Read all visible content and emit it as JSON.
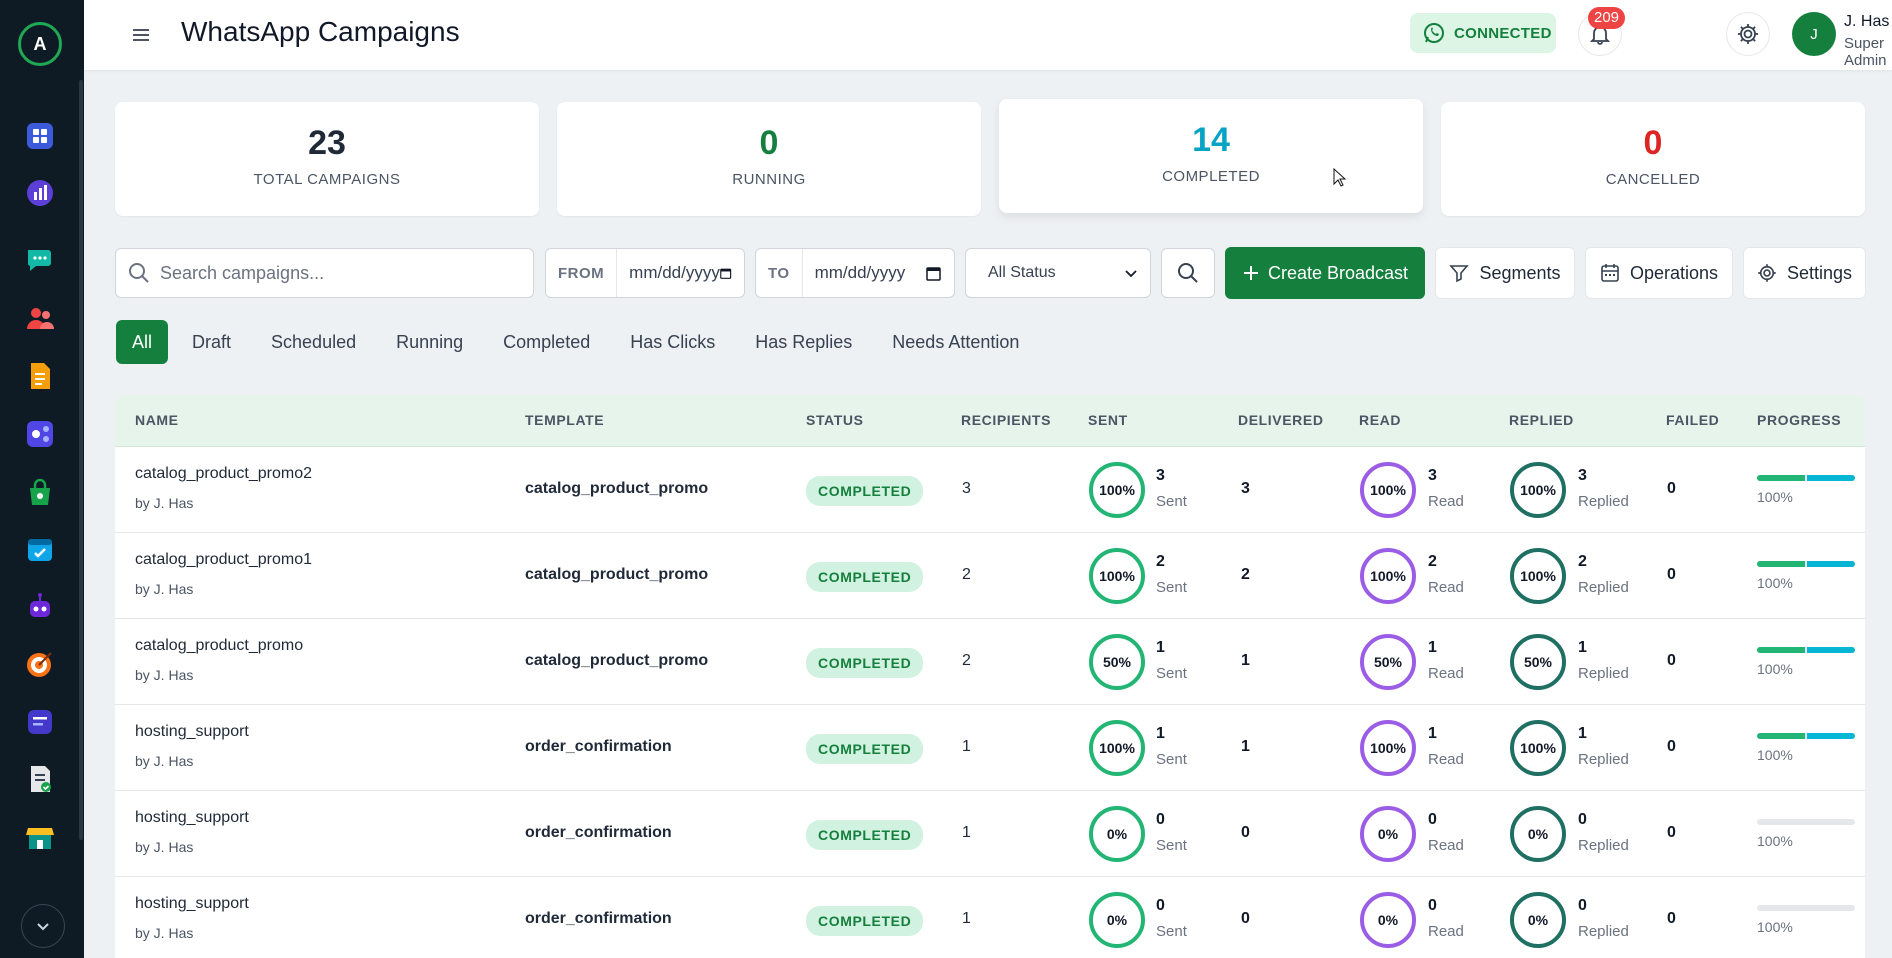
{
  "header": {
    "title": "WhatsApp Campaigns",
    "connection_status": "CONNECTED",
    "notification_count": "209",
    "user_initial": "J",
    "user_name": "J. Has",
    "user_role": "Super Admin"
  },
  "sidebar": {
    "logo_letter": "A",
    "items": [
      {
        "icon": "dashboard-icon"
      },
      {
        "icon": "analytics-icon"
      },
      {
        "icon": "chat-icon"
      },
      {
        "icon": "contacts-icon"
      },
      {
        "icon": "templates-icon"
      },
      {
        "icon": "flows-icon"
      },
      {
        "icon": "shop-icon"
      },
      {
        "icon": "calendar-icon"
      },
      {
        "icon": "bot-icon"
      },
      {
        "icon": "target-icon"
      },
      {
        "icon": "forms-icon"
      },
      {
        "icon": "reports-icon"
      },
      {
        "icon": "store-icon"
      }
    ]
  },
  "stats": [
    {
      "value": "23",
      "label": "TOTAL CAMPAIGNS",
      "color": "#1f2937"
    },
    {
      "value": "0",
      "label": "RUNNING",
      "color": "#15803d"
    },
    {
      "value": "14",
      "label": "COMPLETED",
      "color": "#06a3c4"
    },
    {
      "value": "0",
      "label": "CANCELLED",
      "color": "#dc2626"
    }
  ],
  "filters": {
    "search_placeholder": "Search campaigns...",
    "from_label": "FROM",
    "from_value": "mm/dd/yyyy",
    "to_label": "TO",
    "to_value": "mm/dd/yyyy",
    "status_value": "All Status"
  },
  "actions": {
    "create": "Create Broadcast",
    "segments": "Segments",
    "operations": "Operations",
    "settings": "Settings"
  },
  "tabs": [
    "All",
    "Draft",
    "Scheduled",
    "Running",
    "Completed",
    "Has Clicks",
    "Has Replies",
    "Needs Attention"
  ],
  "table": {
    "headers": [
      "NAME",
      "TEMPLATE",
      "STATUS",
      "RECIPIENTS",
      "SENT",
      "DELIVERED",
      "READ",
      "REPLIED",
      "FAILED",
      "PROGRESS"
    ],
    "rows": [
      {
        "name": "catalog_product_promo2",
        "by": "by J. Has",
        "template": "catalog_product_promo",
        "status": "COMPLETED",
        "recipients": "3",
        "sent_pct": "100%",
        "sent": "3",
        "sent_lbl": "Sent",
        "delivered": "3",
        "read_pct": "100%",
        "read": "3",
        "read_lbl": "Read",
        "replied_pct": "100%",
        "replied": "3",
        "replied_lbl": "Replied",
        "failed": "0",
        "progress": "100%",
        "bar_fill": 1
      },
      {
        "name": "catalog_product_promo1",
        "by": "by J. Has",
        "template": "catalog_product_promo",
        "status": "COMPLETED",
        "recipients": "2",
        "sent_pct": "100%",
        "sent": "2",
        "sent_lbl": "Sent",
        "delivered": "2",
        "read_pct": "100%",
        "read": "2",
        "read_lbl": "Read",
        "replied_pct": "100%",
        "replied": "2",
        "replied_lbl": "Replied",
        "failed": "0",
        "progress": "100%",
        "bar_fill": 1
      },
      {
        "name": "catalog_product_promo",
        "by": "by J. Has",
        "template": "catalog_product_promo",
        "status": "COMPLETED",
        "recipients": "2",
        "sent_pct": "50%",
        "sent": "1",
        "sent_lbl": "Sent",
        "delivered": "1",
        "read_pct": "50%",
        "read": "1",
        "read_lbl": "Read",
        "replied_pct": "50%",
        "replied": "1",
        "replied_lbl": "Replied",
        "failed": "0",
        "progress": "100%",
        "bar_fill": 1
      },
      {
        "name": "hosting_support",
        "by": "by J. Has",
        "template": "order_confirmation",
        "status": "COMPLETED",
        "recipients": "1",
        "sent_pct": "100%",
        "sent": "1",
        "sent_lbl": "Sent",
        "delivered": "1",
        "read_pct": "100%",
        "read": "1",
        "read_lbl": "Read",
        "replied_pct": "100%",
        "replied": "1",
        "replied_lbl": "Replied",
        "failed": "0",
        "progress": "100%",
        "bar_fill": 1
      },
      {
        "name": "hosting_support",
        "by": "by J. Has",
        "template": "order_confirmation",
        "status": "COMPLETED",
        "recipients": "1",
        "sent_pct": "0%",
        "sent": "0",
        "sent_lbl": "Sent",
        "delivered": "0",
        "read_pct": "0%",
        "read": "0",
        "read_lbl": "Read",
        "replied_pct": "0%",
        "replied": "0",
        "replied_lbl": "Replied",
        "failed": "0",
        "progress": "100%",
        "bar_fill": 0
      },
      {
        "name": "hosting_support",
        "by": "by J. Has",
        "template": "order_confirmation",
        "status": "COMPLETED",
        "recipients": "1",
        "sent_pct": "0%",
        "sent": "0",
        "sent_lbl": "Sent",
        "delivered": "0",
        "read_pct": "0%",
        "read": "0",
        "read_lbl": "Read",
        "replied_pct": "0%",
        "replied": "0",
        "replied_lbl": "Replied",
        "failed": "0",
        "progress": "100%",
        "bar_fill": 0
      }
    ]
  }
}
